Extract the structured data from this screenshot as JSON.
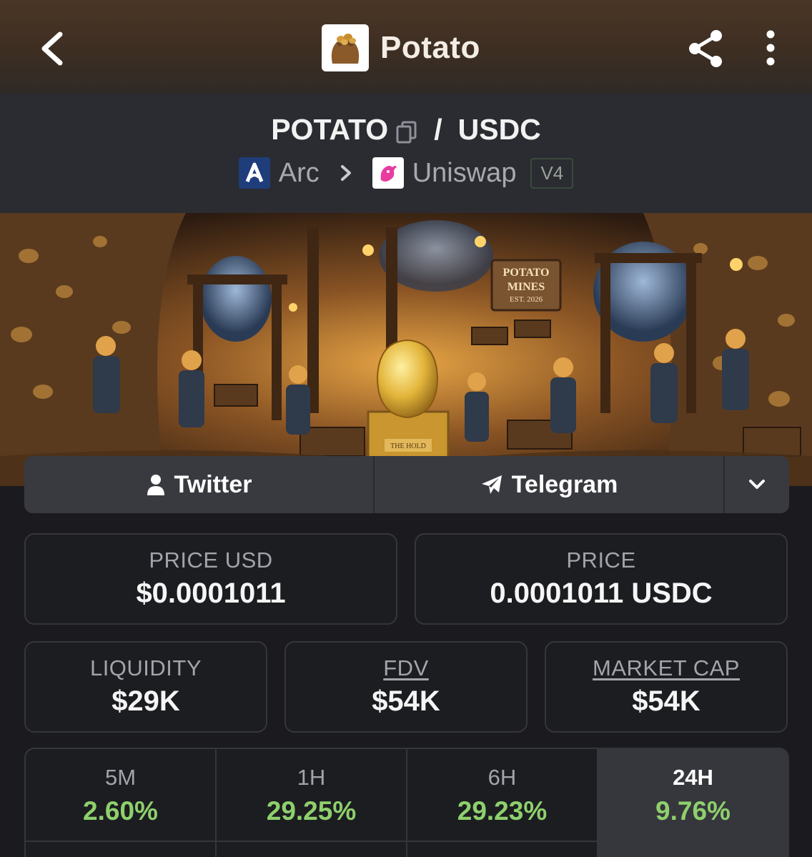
{
  "header": {
    "title": "Potato",
    "back_icon": "chevron-left-icon",
    "share_icon": "share-icon",
    "more_icon": "more-vertical-icon",
    "logo": "potato-sack-logo"
  },
  "pair": {
    "base": "POTATO",
    "separator": "/",
    "quote": "USDC",
    "chain": "Arc",
    "dex": "Uniswap",
    "version": "V4"
  },
  "banner": {
    "sign_line1": "POTATO",
    "sign_line2": "MINES",
    "sign_line3": "EST. 2026",
    "pedestal_text": "THE HOLD"
  },
  "social": {
    "twitter": "Twitter",
    "telegram": "Telegram"
  },
  "stats": {
    "price_usd_label": "PRICE USD",
    "price_usd_value": "$0.0001011",
    "price_label": "PRICE",
    "price_value": "0.0001011 USDC",
    "liquidity_label": "LIQUIDITY",
    "liquidity_value": "$29K",
    "fdv_label": "FDV",
    "fdv_value": "$54K",
    "mcap_label": "MARKET CAP",
    "mcap_value": "$54K"
  },
  "changes": [
    {
      "label": "5M",
      "value": "2.60%"
    },
    {
      "label": "1H",
      "value": "29.25%"
    },
    {
      "label": "6H",
      "value": "29.23%"
    },
    {
      "label": "24H",
      "value": "9.76%"
    }
  ],
  "colors": {
    "accent_green": "#8ed06c",
    "background": "#1b1b1f",
    "header_brown": "#4a3626"
  }
}
